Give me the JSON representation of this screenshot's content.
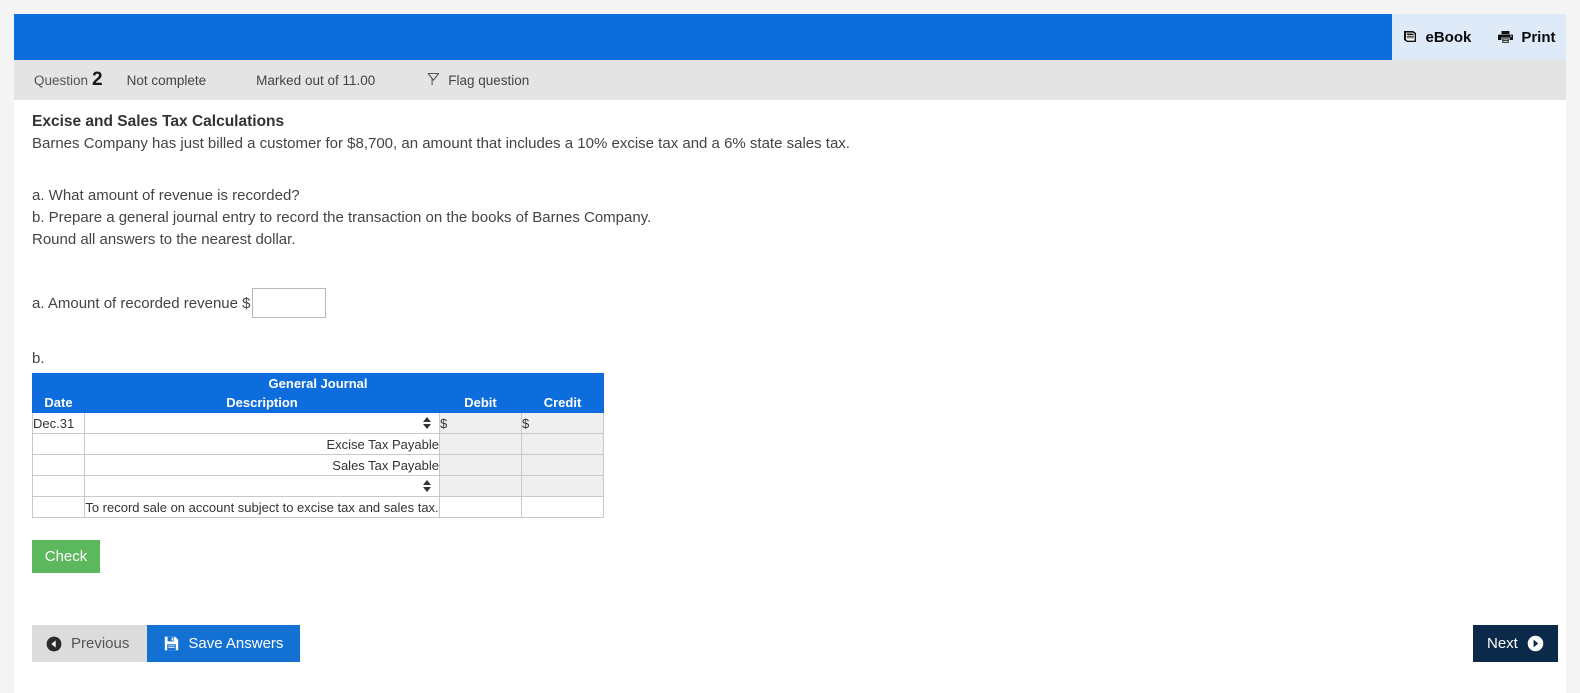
{
  "toolbar": {
    "ebook_label": "eBook",
    "ebook_icon": "book-icon",
    "print_label": "Print",
    "print_icon": "printer-icon"
  },
  "question_info": {
    "question_label": "Question",
    "question_number": "2",
    "completion_state": "Not complete",
    "marks": "Marked out of 11.00",
    "flag_label": "Flag question",
    "flag_icon": "flag-icon"
  },
  "question": {
    "title": "Excise and Sales Tax Calculations",
    "body": "Barnes Company has just billed a customer for $8,700, an amount that includes a 10% excise tax and a 6% state sales tax.",
    "requirement_a": "a. What amount of revenue is recorded?",
    "requirement_b": "b. Prepare a general journal entry to record the transaction on the books of Barnes Company.",
    "requirement_c": "Round all answers to the nearest dollar."
  },
  "part_a": {
    "label": "a. Amount of recorded revenue $",
    "value": "",
    "placeholder": ""
  },
  "part_b": {
    "label": "b."
  },
  "journal": {
    "title": "General Journal",
    "columns": [
      "Date",
      "Description",
      "Debit",
      "Credit"
    ],
    "rows": [
      {
        "date": "Dec.31",
        "description": "",
        "description_type": "select",
        "debit": "$",
        "credit": "$",
        "shaded": true
      },
      {
        "date": "",
        "description": "Excise Tax Payable",
        "description_type": "text-indent",
        "debit": "",
        "credit": "",
        "shaded": true
      },
      {
        "date": "",
        "description": "Sales Tax Payable",
        "description_type": "text-indent",
        "debit": "",
        "credit": "",
        "shaded": true
      },
      {
        "date": "",
        "description": "",
        "description_type": "select",
        "debit": "",
        "credit": "",
        "shaded": true
      },
      {
        "date": "",
        "description": "To record sale on account subject to excise tax and sales tax.",
        "description_type": "text-center",
        "debit": "",
        "credit": "",
        "shaded": false
      }
    ]
  },
  "actions": {
    "check_label": "Check",
    "previous_label": "Previous",
    "save_label": "Save Answers",
    "next_label": "Next",
    "previous_icon": "circle-arrow-left-icon",
    "save_icon": "floppy-disk-icon",
    "next_icon": "circle-arrow-right-icon"
  },
  "colors": {
    "brand_blue": "#0d6ddc",
    "panel_blue": "#deeaf7",
    "check_green": "#5cb85c",
    "save_blue": "#1471d4",
    "next_navy": "#0b2a4a",
    "strip_gray": "#e4e4e4"
  }
}
